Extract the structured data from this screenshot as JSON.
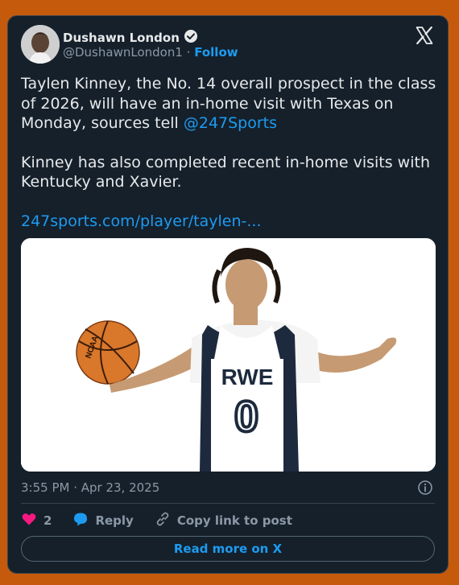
{
  "author": {
    "name": "Dushawn London",
    "handle": "@DushawnLondon1",
    "separator": "·",
    "follow_label": "Follow"
  },
  "tweet": {
    "line1_text": "Taylen Kinney, the No. 14 overall prospect in the class of 2026, will have an in-home visit with Texas on Monday, sources tell ",
    "mention": "@247Sports",
    "line2_text": "Kinney has also completed recent in-home visits with Kentucky and Xavier.",
    "link": "247sports.com/player/taylen-..."
  },
  "media": {
    "jersey_text": "RWE",
    "jersey_number": "0",
    "ball_text": "NCAA"
  },
  "meta": {
    "timestamp": "3:55 PM · Apr 23, 2025"
  },
  "actions": {
    "like_count": "2",
    "reply_label": "Reply",
    "copy_label": "Copy link to post"
  },
  "footer": {
    "read_more_label": "Read more on X"
  },
  "colors": {
    "background": "#c65a0c",
    "card": "#15202b",
    "accent": "#1d9bf0",
    "like": "#f91880"
  },
  "icons": [
    "verified-badge-icon",
    "x-logo-icon",
    "info-icon",
    "heart-icon",
    "reply-icon",
    "link-icon"
  ]
}
